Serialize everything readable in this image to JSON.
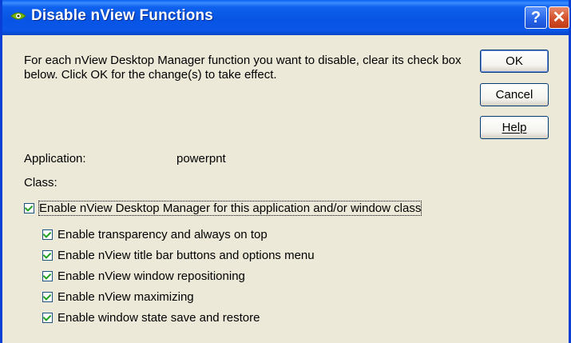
{
  "window": {
    "title": "Disable nView Functions"
  },
  "titlebar": {
    "help_label": "?",
    "close_label": "✕"
  },
  "description": "For each nView Desktop Manager function you want to disable, clear its check box below. Click OK for the change(s) to take effect.",
  "buttons": {
    "ok": "OK",
    "cancel": "Cancel",
    "help": "Help"
  },
  "info": {
    "application_label": "Application:",
    "application_value": "powerpnt",
    "class_label": "Class:"
  },
  "main_checkbox": {
    "label": "Enable nView Desktop Manager for this application and/or window class",
    "checked": true
  },
  "options": [
    {
      "label": "Enable transparency and always on top",
      "checked": true
    },
    {
      "label": "Enable nView title bar buttons and options menu",
      "checked": true
    },
    {
      "label": "Enable nView window repositioning",
      "checked": true
    },
    {
      "label": "Enable nView maximizing",
      "checked": true
    },
    {
      "label": "Enable window state save and restore",
      "checked": true
    }
  ],
  "colors": {
    "titlebar": "#0a56e8",
    "dialog_bg": "#ece9d8",
    "check": "#21a121"
  },
  "icons": {
    "app_icon": "nvidia-eye-icon",
    "help": "help-icon",
    "close": "close-icon"
  }
}
